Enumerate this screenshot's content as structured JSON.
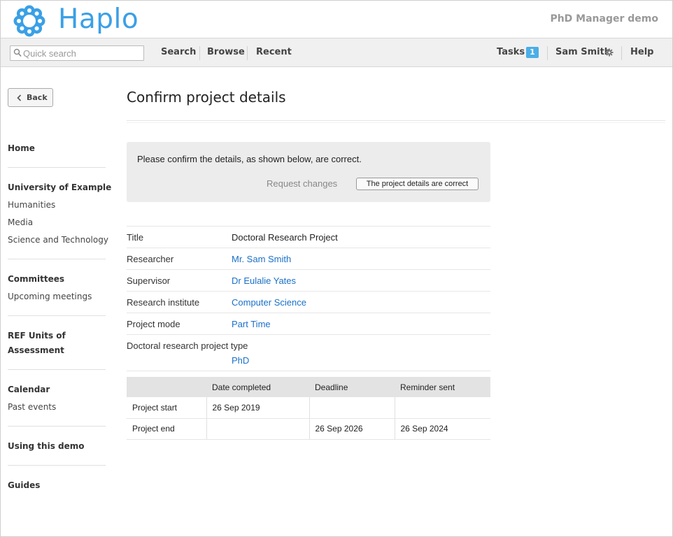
{
  "header": {
    "brand": "Haplo",
    "app_name": "PhD Manager demo",
    "colors": {
      "brand": "#3aa0e6",
      "link": "#1a70c8",
      "badge": "#4aaee6"
    }
  },
  "navbar": {
    "search_placeholder": "Quick search",
    "links": {
      "search": "Search",
      "browse": "Browse",
      "recent": "Recent",
      "tasks": "Tasks",
      "user": "Sam Smith",
      "help": "Help"
    },
    "tasks_count": "1"
  },
  "sidebar": {
    "back_label": "Back",
    "sections": {
      "home": "Home",
      "university": "University of Example",
      "humanities": "Humanities",
      "media": "Media",
      "science": "Science and Technology",
      "committees": "Committees",
      "upcoming": "Upcoming meetings",
      "ref_line1": "REF Units of",
      "ref_line2": "Assessment",
      "calendar": "Calendar",
      "past_events": "Past events",
      "using_demo": "Using this demo",
      "guides": "Guides"
    }
  },
  "main": {
    "title": "Confirm project details",
    "confirm": {
      "message": "Please confirm the details, as shown below, are correct.",
      "request_changes": "Request changes",
      "confirm_button": "The project details are correct"
    },
    "attributes": [
      {
        "label": "Title",
        "value": "Doctoral Research Project"
      },
      {
        "label": "Researcher",
        "value": "Mr. Sam Smith"
      },
      {
        "label": "Supervisor",
        "value": "Dr Eulalie Yates"
      },
      {
        "label": "Research institute",
        "value": "Computer Science"
      },
      {
        "label": "Project mode",
        "value": "Part Time"
      },
      {
        "label": "Doctoral research project type",
        "value": "PhD"
      }
    ],
    "dates_table": {
      "headers": [
        "",
        "Date completed",
        "Deadline",
        "Reminder sent"
      ],
      "rows": [
        [
          "Project start",
          "26 Sep 2019",
          "",
          ""
        ],
        [
          "Project end",
          "",
          "26 Sep 2026",
          "26 Sep 2024"
        ]
      ]
    }
  }
}
